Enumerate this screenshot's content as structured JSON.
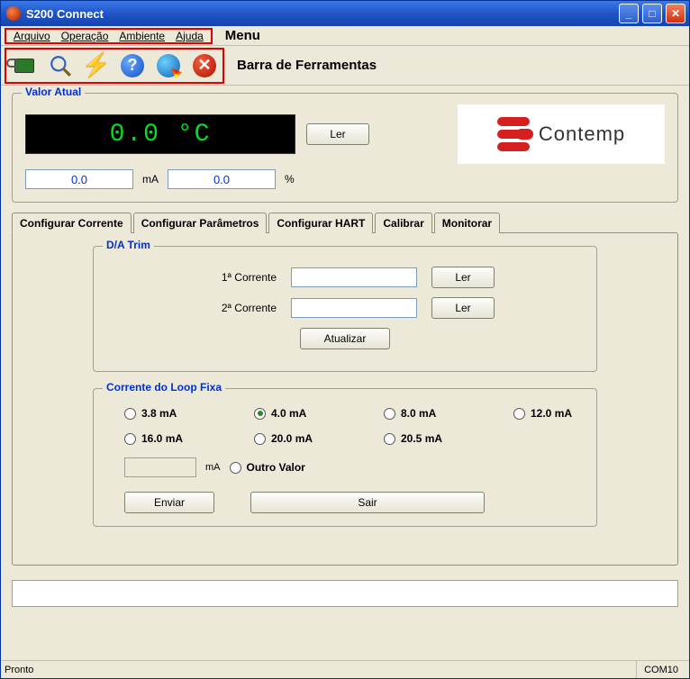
{
  "window": {
    "title": "S200 Connect"
  },
  "menu": {
    "items": [
      "Arquivo",
      "Operação",
      "Ambiente",
      "Ajuda"
    ],
    "label": "Menu"
  },
  "toolbar": {
    "label": "Barra de Ferramentas"
  },
  "valor_atual": {
    "legend": "Valor Atual",
    "display": "0.0  °C",
    "ler": "Ler",
    "ma_value": "0.0",
    "ma_unit": "mA",
    "pct_value": "0.0",
    "pct_unit": "%"
  },
  "logo": {
    "text": "Contemp"
  },
  "tabs": {
    "items": [
      "Configurar Corrente",
      "Configurar Parâmetros",
      "Configurar HART",
      "Calibrar",
      "Monitorar"
    ],
    "active": 0
  },
  "da_trim": {
    "legend": "D/A Trim",
    "corrente1_label": "1ª Corrente",
    "corrente1_value": "",
    "corrente2_label": "2ª Corrente",
    "corrente2_value": "",
    "ler": "Ler",
    "atualizar": "Atualizar"
  },
  "loop": {
    "legend": "Corrente do Loop Fixa",
    "options": [
      "3.8 mA",
      "4.0 mA",
      "8.0 mA",
      "12.0 mA",
      "16.0 mA",
      "20.0 mA",
      "20.5 mA"
    ],
    "selected": 1,
    "outro_value": "",
    "outro_unit": "mA",
    "outro_label": "Outro Valor",
    "enviar": "Enviar",
    "sair": "Sair"
  },
  "status": {
    "left": "Pronto",
    "right": "COM10"
  }
}
